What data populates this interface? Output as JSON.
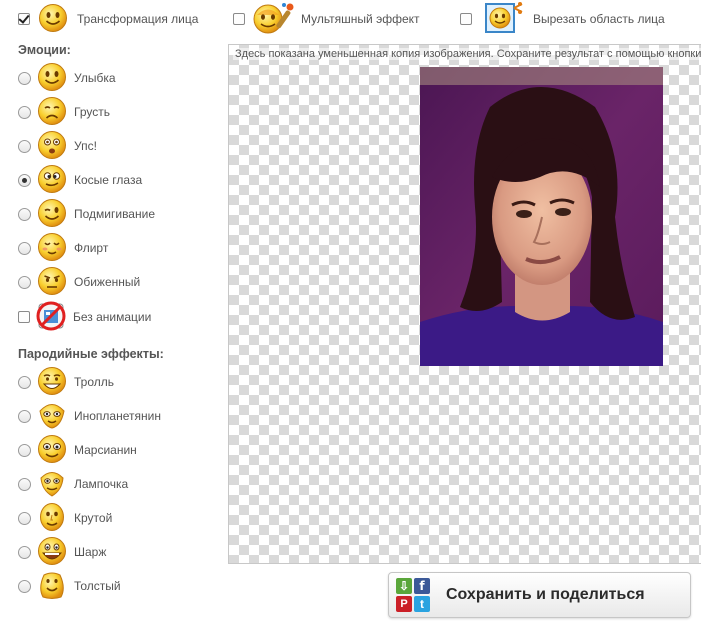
{
  "top_options": [
    {
      "label": "Трансформация лица",
      "checked": true,
      "icon": "smiley-face-icon"
    },
    {
      "label": "Мультяшный эффект",
      "checked": false,
      "icon": "cartoon-paint-icon"
    },
    {
      "label": "Вырезать область лица",
      "checked": false,
      "icon": "crop-face-icon"
    }
  ],
  "emotions": {
    "title": "Эмоции:",
    "items": [
      {
        "label": "Улыбка",
        "selected": false,
        "icon": "smile-icon"
      },
      {
        "label": "Грусть",
        "selected": false,
        "icon": "sad-icon"
      },
      {
        "label": "Упс!",
        "selected": false,
        "icon": "oops-icon"
      },
      {
        "label": "Косые глаза",
        "selected": true,
        "icon": "cross-eyed-icon"
      },
      {
        "label": "Подмигивание",
        "selected": false,
        "icon": "wink-icon"
      },
      {
        "label": "Флирт",
        "selected": false,
        "icon": "flirt-icon"
      },
      {
        "label": "Обиженный",
        "selected": false,
        "icon": "offended-icon"
      }
    ],
    "no_animation": {
      "label": "Без анимации",
      "checked": false,
      "icon": "no-animation-icon"
    }
  },
  "parody": {
    "title": "Пародийные эффекты:",
    "items": [
      {
        "label": "Тролль",
        "selected": false,
        "icon": "troll-icon"
      },
      {
        "label": "Инопланетянин",
        "selected": false,
        "icon": "alien-icon"
      },
      {
        "label": "Марсианин",
        "selected": false,
        "icon": "martian-icon"
      },
      {
        "label": "Лампочка",
        "selected": false,
        "icon": "lightbulb-head-icon"
      },
      {
        "label": "Крутой",
        "selected": false,
        "icon": "cool-icon"
      },
      {
        "label": "Шарж",
        "selected": false,
        "icon": "caricature-icon"
      },
      {
        "label": "Толстый",
        "selected": false,
        "icon": "fat-face-icon"
      }
    ]
  },
  "preview": {
    "notice": "Здесь показана уменьшенная копия изображения. Сохраните результат с помощью кнопки"
  },
  "save_button": {
    "label": "Сохранить и поделиться",
    "social": [
      {
        "name": "download-icon",
        "glyph": "⇩"
      },
      {
        "name": "facebook-icon",
        "glyph": "f"
      },
      {
        "name": "pinterest-icon",
        "glyph": "P"
      },
      {
        "name": "twitter-icon",
        "glyph": "t"
      }
    ]
  }
}
